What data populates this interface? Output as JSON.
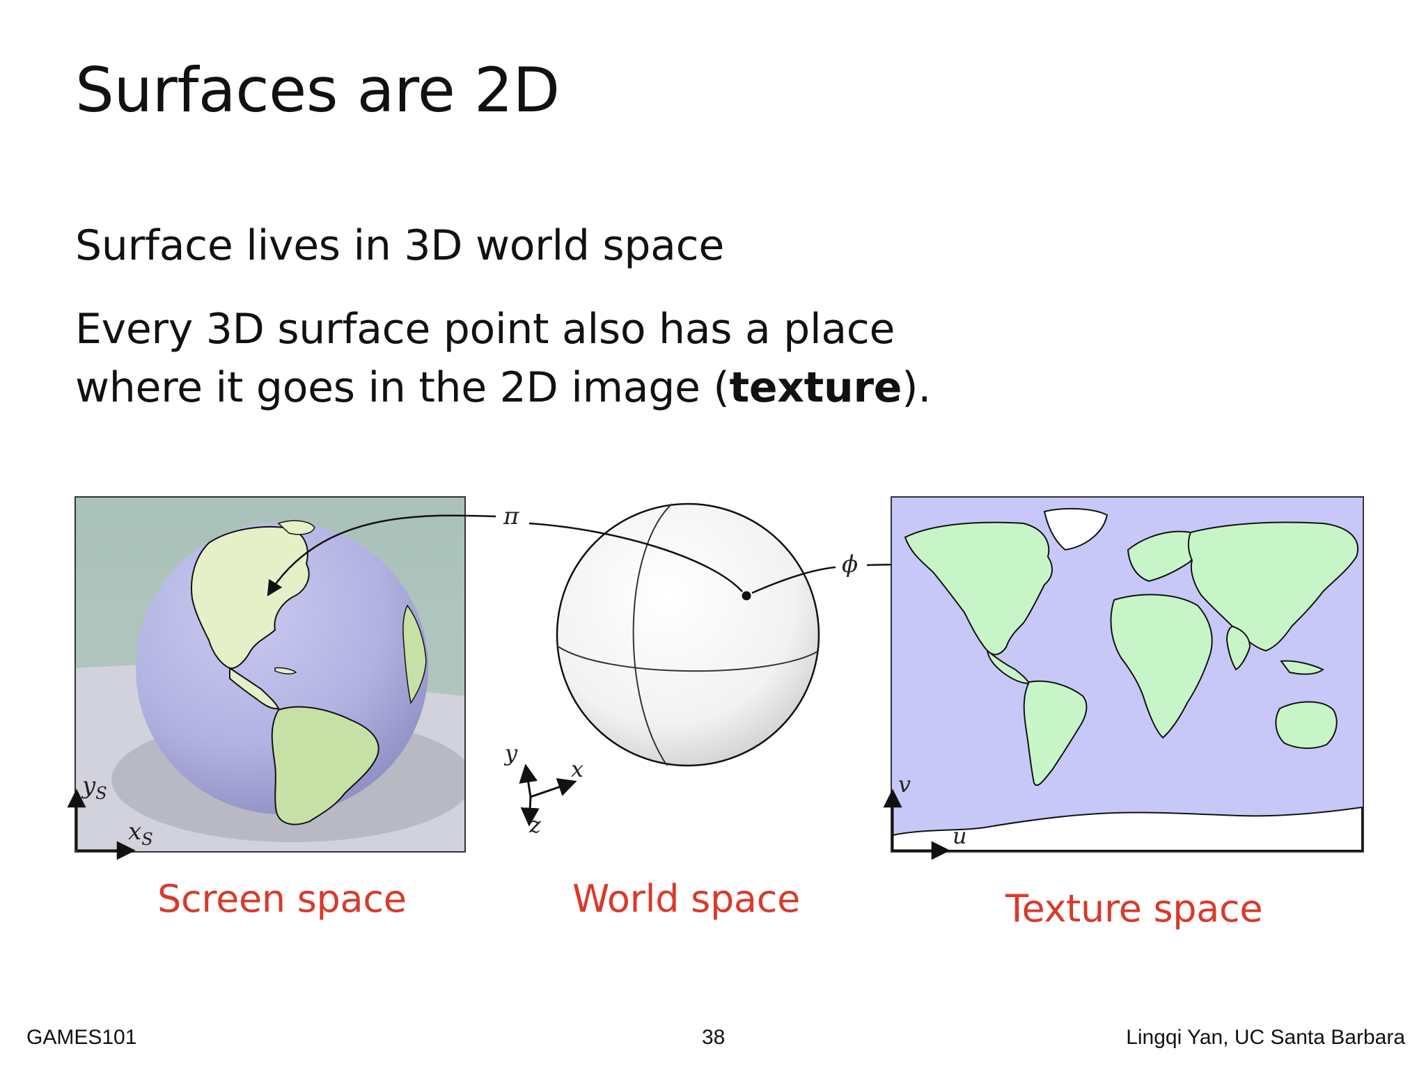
{
  "slide": {
    "title": "Surfaces are 2D",
    "bullet1": "Surface lives in 3D world space",
    "bullet2_line1": "Every 3D surface point also has a place",
    "bullet2_line2_before": "where it goes in the 2D image (",
    "bullet2_bold": "texture",
    "bullet2_line2_after": ")."
  },
  "figure": {
    "labels": {
      "pi": "π",
      "phi": "ϕ",
      "ys": "ys",
      "ys_base": "y",
      "ys_sub": "S",
      "xs_base": "x",
      "xs_sub": "S",
      "y": "y",
      "x": "x",
      "z": "z",
      "v": "v",
      "u": "u"
    },
    "captions": {
      "screen": "Screen space",
      "world": "World space",
      "texture": "Texture space"
    },
    "colors": {
      "caption": "#d93a2b",
      "ocean_texture": "#c8c8f5",
      "land": "#c8f5c8",
      "globe": "#b0b0e0",
      "background_wall": "#a9c1b8"
    }
  },
  "footer": {
    "left": "GAMES101",
    "page_number": "38",
    "right": "Lingqi Yan, UC Santa Barbara"
  }
}
